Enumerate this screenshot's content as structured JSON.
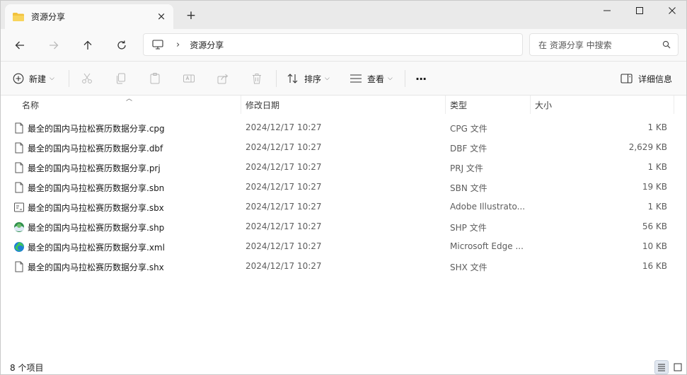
{
  "tab": {
    "title": "资源分享",
    "close": "×",
    "new_tab": "+"
  },
  "window_controls": {
    "minimize": "—",
    "maximize": "☐",
    "close": "✕"
  },
  "address": {
    "crumb": "资源分享",
    "separator": "›"
  },
  "search": {
    "placeholder": "在 资源分享 中搜索"
  },
  "commands": {
    "new_label": "新建",
    "sort_label": "排序",
    "view_label": "查看",
    "more": "···",
    "details_label": "详细信息"
  },
  "columns": {
    "name": "名称",
    "date": "修改日期",
    "type": "类型",
    "size": "大小"
  },
  "files": [
    {
      "name": "最全的国内马拉松赛历数据分享.cpg",
      "date": "2024/12/17 10:27",
      "type": "CPG 文件",
      "size": "1 KB",
      "icon": "file-icon"
    },
    {
      "name": "最全的国内马拉松赛历数据分享.dbf",
      "date": "2024/12/17 10:27",
      "type": "DBF 文件",
      "size": "2,629 KB",
      "icon": "file-icon"
    },
    {
      "name": "最全的国内马拉松赛历数据分享.prj",
      "date": "2024/12/17 10:27",
      "type": "PRJ 文件",
      "size": "1 KB",
      "icon": "file-icon"
    },
    {
      "name": "最全的国内马拉松赛历数据分享.sbn",
      "date": "2024/12/17 10:27",
      "type": "SBN 文件",
      "size": "19 KB",
      "icon": "file-icon"
    },
    {
      "name": "最全的国内马拉松赛历数据分享.sbx",
      "date": "2024/12/17 10:27",
      "type": "Adobe Illustrato...",
      "size": "1 KB",
      "icon": "illustrator-file-icon"
    },
    {
      "name": "最全的国内马拉松赛历数据分享.shp",
      "date": "2024/12/17 10:27",
      "type": "SHP 文件",
      "size": "56 KB",
      "icon": "shape-file-icon"
    },
    {
      "name": "最全的国内马拉松赛历数据分享.xml",
      "date": "2024/12/17 10:27",
      "type": "Microsoft Edge ...",
      "size": "10 KB",
      "icon": "edge-icon"
    },
    {
      "name": "最全的国内马拉松赛历数据分享.shx",
      "date": "2024/12/17 10:27",
      "type": "SHX 文件",
      "size": "16 KB",
      "icon": "file-icon"
    }
  ],
  "status": {
    "count_text": "8 个项目"
  },
  "colors": {
    "folder": "#f2c23c",
    "edge_blue": "#1d7fd8",
    "edge_green": "#3ec45b",
    "accent": "#1a1a1a"
  }
}
